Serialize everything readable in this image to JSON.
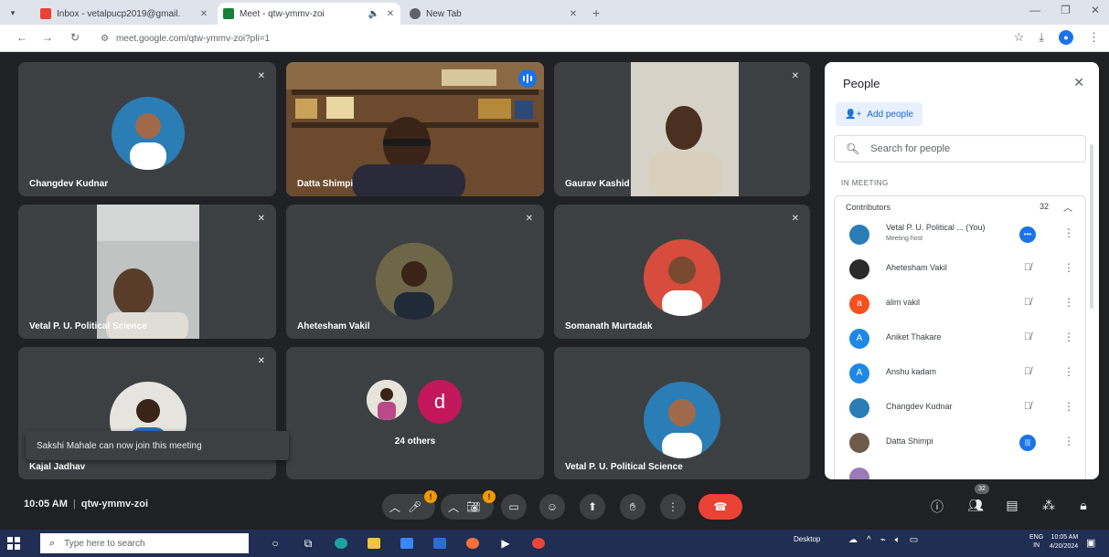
{
  "browser": {
    "tabs": [
      {
        "label": "Inbox - vetalpucp2019@gmail.",
        "favicon_color": "#ea4335",
        "active": false
      },
      {
        "label": "Meet - qtw-ymmv-zoi",
        "favicon_color": "#188038",
        "active": true
      },
      {
        "label": "New Tab",
        "favicon_color": "#5f6368",
        "active": false
      }
    ],
    "url": "meet.google.com/qtw-ymmv-zoi?pli=1"
  },
  "meeting": {
    "tiles": [
      {
        "name": "Changdev Kudnar",
        "kind": "avatar",
        "avatar_color": "#2a7db5",
        "muted": true
      },
      {
        "name": "Datta Shimpi",
        "kind": "video",
        "speaking": true,
        "muted": false
      },
      {
        "name": "Gaurav Kashid",
        "kind": "video",
        "muted": true
      },
      {
        "name": "Vetal P. U. Political Science",
        "kind": "video",
        "muted": true
      },
      {
        "name": "Ahetesham Vakil",
        "kind": "avatar",
        "avatar_color": "#8a7a52",
        "muted": true
      },
      {
        "name": "Somanath Murtadak",
        "kind": "avatar",
        "avatar_color": "#d64c3d",
        "muted": false
      },
      {
        "name": "Kajal Jadhav",
        "kind": "avatar",
        "avatar_color": "#7fa3c7",
        "muted": true
      },
      {
        "name": "24 others",
        "kind": "others",
        "others_letter": "d",
        "others_color": "#c2185b",
        "muted": false
      },
      {
        "name": "Vetal P. U. Political Science",
        "kind": "avatar",
        "avatar_color": "#2a7db5",
        "muted": false
      }
    ],
    "toast": "Sakshi Mahale can now join this meeting",
    "time": "10:05 AM",
    "code": "qtw-ymmv-zoi",
    "people_badge": "32"
  },
  "people_panel": {
    "title": "People",
    "add_people": "Add people",
    "search_placeholder": "Search for people",
    "section": "IN MEETING",
    "group_label": "Contributors",
    "group_count": "32",
    "participants": [
      {
        "name": "Vetal P. U. Political ... (You)",
        "subtitle": "Meeting host",
        "avatar_letter": "",
        "avatar_color": "#2a7db5",
        "mic": "more-blue"
      },
      {
        "name": "Ahetesham Vakil",
        "subtitle": "",
        "avatar_letter": "",
        "avatar_color": "#2b2b2b",
        "mic": "muted"
      },
      {
        "name": "alim vakil",
        "subtitle": "",
        "avatar_letter": "a",
        "avatar_color": "#f4511e",
        "mic": "muted"
      },
      {
        "name": "Aniket Thakare",
        "subtitle": "",
        "avatar_letter": "A",
        "avatar_color": "#1e88e5",
        "mic": "muted"
      },
      {
        "name": "Anshu kadam",
        "subtitle": "",
        "avatar_letter": "A",
        "avatar_color": "#1e88e5",
        "mic": "muted"
      },
      {
        "name": "Changdev Kudnar",
        "subtitle": "",
        "avatar_letter": "",
        "avatar_color": "#2a7db5",
        "mic": "muted"
      },
      {
        "name": "Datta Shimpi",
        "subtitle": "",
        "avatar_letter": "",
        "avatar_color": "#6d5b4c",
        "mic": "speaking"
      }
    ]
  },
  "taskbar": {
    "search_placeholder": "Type here to search",
    "desktop_label": "Desktop",
    "lang_top": "ENG",
    "lang_bottom": "IN",
    "clock_time": "10:05 AM",
    "clock_date": "4/20/2024"
  }
}
